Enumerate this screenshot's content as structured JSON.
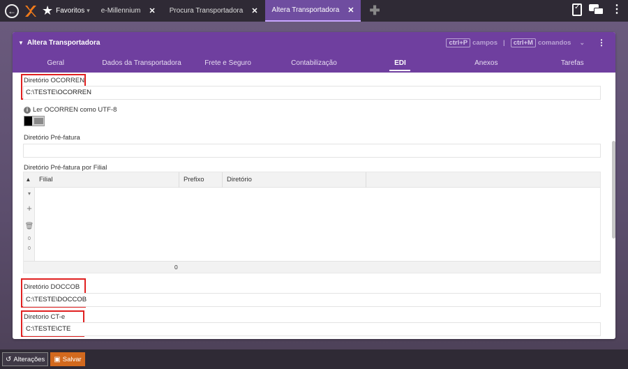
{
  "topbar": {
    "favorites_label": "Favoritos",
    "tabs": [
      {
        "label": "e-Millennium"
      },
      {
        "label": "Procura Transportadora"
      },
      {
        "label": "Altera Transportadora"
      }
    ]
  },
  "panel": {
    "title": "Altera Transportadora",
    "shortcut_fields_key": "ctrl+P",
    "shortcut_fields_label": "campos",
    "separator": "|",
    "shortcut_commands_key": "ctrl+M",
    "shortcut_commands_label": "comandos",
    "tabs": [
      "Geral",
      "Dados da Transportadora",
      "Frete e Seguro",
      "Contabilização",
      "EDI",
      "Anexos",
      "Tarefas"
    ],
    "active_tab": "EDI"
  },
  "form": {
    "ocorren_label": "Diretório OCORREN",
    "ocorren_value": "C:\\TESTE\\OCORREN",
    "utf8_label": "Ler OCORREN como UTF-8",
    "prefatura_label": "Diretório Pré-fatura",
    "prefatura_value": "",
    "prefatura_filial_label": "Diretório Pré-fatura por Filial",
    "grid": {
      "columns": [
        "Filial",
        "Prefixo",
        "Diretório"
      ],
      "side_values": [
        "0",
        "0"
      ],
      "footer_value": "0"
    },
    "doccob_label": "Diretório DOCCOB",
    "doccob_value": "C:\\TESTE\\DOCCOB",
    "cte_label": "Diretorio CT-e",
    "cte_value": "C:\\TESTE\\CTE"
  },
  "bottombar": {
    "changes_label": "Alterações",
    "save_label": "Salvar"
  },
  "colors": {
    "accent": "#6f3f9f",
    "highlight_box": "#e02020",
    "save_button": "#d2691e"
  }
}
